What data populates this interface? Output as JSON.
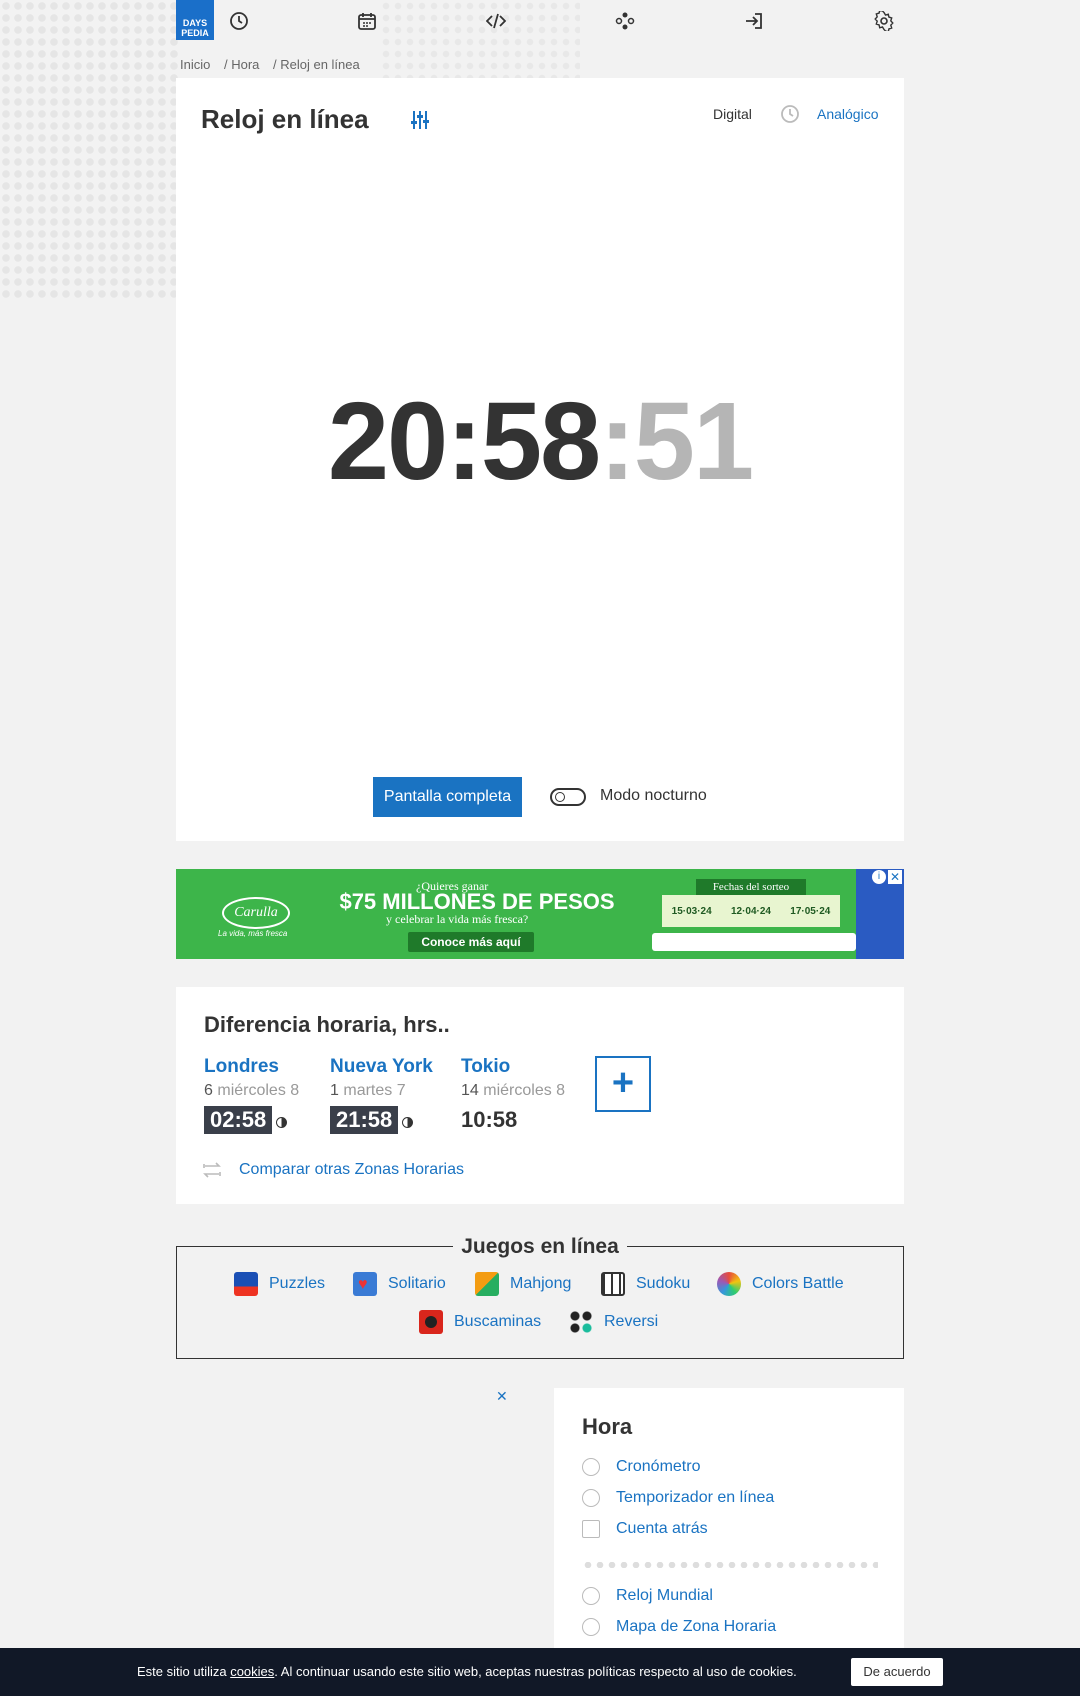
{
  "brand": {
    "logo_line1": "DAYS",
    "logo_line2": "PEDIA"
  },
  "nav": {
    "icons": [
      "clock-icon",
      "calendar-icon",
      "code-icon",
      "games-icon",
      "login-icon",
      "gear-icon"
    ]
  },
  "breadcrumb": [
    "Inicio",
    "/ Hora",
    "/ Reloj en línea"
  ],
  "clock": {
    "title": "Reloj en línea",
    "mode_digital": "Digital",
    "mode_analog": "Analógico",
    "time_hm": "20:58",
    "time_sec": ":51",
    "fullscreen_label": "Pantalla completa",
    "night_mode_label": "Modo nocturno"
  },
  "ad": {
    "brand": "Carulla",
    "tagline": "La vida, más fresca",
    "question": "¿Quieres ganar",
    "headline": "$75 MILLONES DE PESOS",
    "subline": "y celebrar la vida más fresca?",
    "cta": "Conoce más aquí",
    "dates_title": "Fechas del sorteo",
    "dates": [
      "15·03·24",
      "12·04·24",
      "17·05·24"
    ]
  },
  "time_diff": {
    "title": "Diferencia horaria, hrs..",
    "cities": [
      {
        "name": "Londres",
        "offset": "6",
        "day": "miércoles 8",
        "time": "02:58"
      },
      {
        "name": "Nueva York",
        "offset": "1",
        "day": "martes 7",
        "time": "21:58"
      },
      {
        "name": "Tokio",
        "offset": "14",
        "day": "miércoles 8",
        "time": "10:58"
      }
    ],
    "add_label": "+",
    "compare_label": "Comparar otras Zonas Horarias"
  },
  "games": {
    "title": "Juegos en línea",
    "items": [
      "Puzzles",
      "Solitario",
      "Mahjong",
      "Sudoku",
      "Colors Battle",
      "Buscaminas",
      "Reversi"
    ]
  },
  "hora": {
    "title": "Hora",
    "items": [
      "Cronómetro",
      "Temporizador en línea",
      "Cuenta atrás",
      "Reloj Mundial",
      "Mapa de Zona Horaria"
    ]
  },
  "cookie": {
    "text_before": "Este sitio utiliza ",
    "link": "cookies",
    "text_after": ". Al continuar usando este sitio web, aceptas nuestras políticas respecto al uso de cookies.",
    "button": "De acuerdo"
  },
  "ad_close": "✕"
}
